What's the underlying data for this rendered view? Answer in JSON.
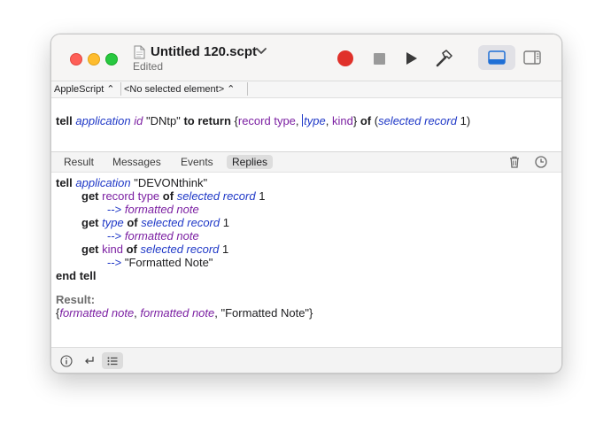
{
  "window": {
    "title": "Untitled 120.scpt",
    "subtitle": "Edited"
  },
  "toolbar": {
    "record": "record-icon",
    "stop": "stop-icon",
    "run": "play-icon",
    "compile": "hammer-icon",
    "view_bottom": "bottom-pane-icon",
    "view_side": "side-pane-icon"
  },
  "navbar": {
    "language": "AppleScript ⌃",
    "element": "<No selected element> ⌃"
  },
  "editor": {
    "tell": "tell",
    "application": "application",
    "id": "id",
    "app_id": "\"DNtp\"",
    "to": "to",
    "return": "return",
    "open_brace": "{",
    "record_type": "record type",
    "comma1": ",",
    "type": "type",
    "comma2": ",",
    "kind": "kind",
    "close_brace": "}",
    "of": "of",
    "open_paren": "(",
    "selected_record": "selected record",
    "one": "1)"
  },
  "tabs": {
    "result": "Result",
    "messages": "Messages",
    "events": "Events",
    "replies": "Replies"
  },
  "log": {
    "l1_tell": "tell",
    "l1_application": "application",
    "l1_name": "\"DEVONthink\"",
    "l2_get": "get",
    "l2_prop": "record type",
    "l2_of": "of",
    "l2_cls": "selected record",
    "l2_num": "1",
    "l3_arrow": "-->",
    "l3_val": "formatted note",
    "l4_get": "get",
    "l4_prop": "type",
    "l4_of": "of",
    "l4_cls": "selected record",
    "l4_num": "1",
    "l5_arrow": "-->",
    "l5_val": "formatted note",
    "l6_get": "get",
    "l6_prop": "kind",
    "l6_of": "of",
    "l6_cls": "selected record",
    "l6_num": "1",
    "l7_arrow": "-->",
    "l7_val": "\"Formatted Note\"",
    "l8_end": "end tell",
    "result_label": "Result:",
    "r_open": "{",
    "r_v1": "formatted note",
    "r_c1": ",",
    "r_v2": "formatted note",
    "r_c2": ",",
    "r_v3": "\"Formatted Note\"}"
  },
  "colors": {
    "keyword": "#1d1d1f",
    "application": "#1f38c7",
    "property": "#7b1fa2",
    "record_button": "#e0312a"
  }
}
